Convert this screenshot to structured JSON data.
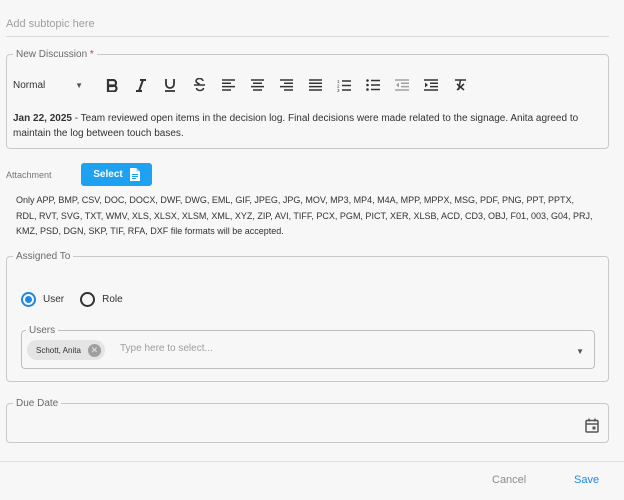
{
  "subtopic": {
    "placeholder": "Add subtopic here"
  },
  "discussion": {
    "legend": "New Discussion",
    "required_mark": "*",
    "style_value": "Normal",
    "toolbar_icons": [
      "bold-icon",
      "italic-icon",
      "underline-icon",
      "strikethrough-icon",
      "align-left-icon",
      "align-center-icon",
      "align-right-icon",
      "align-justify-icon",
      "ordered-list-icon",
      "bullet-list-icon",
      "outdent-icon",
      "indent-icon",
      "clear-format-icon"
    ],
    "entry_date": "Jan 22, 2025",
    "entry_text": " - Team reviewed open items in the decision log. Final decisions were made related to the signage. Anita agreed to maintain the log between touch bases."
  },
  "attachment": {
    "label": "Attachment",
    "button_label": "Select",
    "formats_text": "Only APP, BMP, CSV, DOC, DOCX, DWF, DWG, EML, GIF, JPEG, JPG, MOV, MP3, MP4, M4A, MPP, MPPX, MSG, PDF, PNG, PPT, PPTX, RDL, RVT, SVG, TXT, WMV, XLS, XLSX, XLSM, XML, XYZ, ZIP, AVI, TIFF, PCX, PGM, PICT, XER, XLSB, ACD, CD3, OBJ, F01, 003, G04, PRJ, KMZ, PSD, DGN, SKP, TIF, RFA, DXF file formats will be accepted."
  },
  "assigned": {
    "legend": "Assigned To",
    "options": [
      {
        "label": "User",
        "selected": true
      },
      {
        "label": "Role",
        "selected": false
      }
    ],
    "users_legend": "Users",
    "chips": [
      "Schott, Anita"
    ],
    "input_placeholder": "Type here to select..."
  },
  "due_date": {
    "legend": "Due Date"
  },
  "footer": {
    "cancel_label": "Cancel",
    "save_label": "Save"
  },
  "colors": {
    "accent": "#1ea1f1",
    "radio": "#1e88e5",
    "required": "#e0302a",
    "save": "#1e88e5"
  }
}
